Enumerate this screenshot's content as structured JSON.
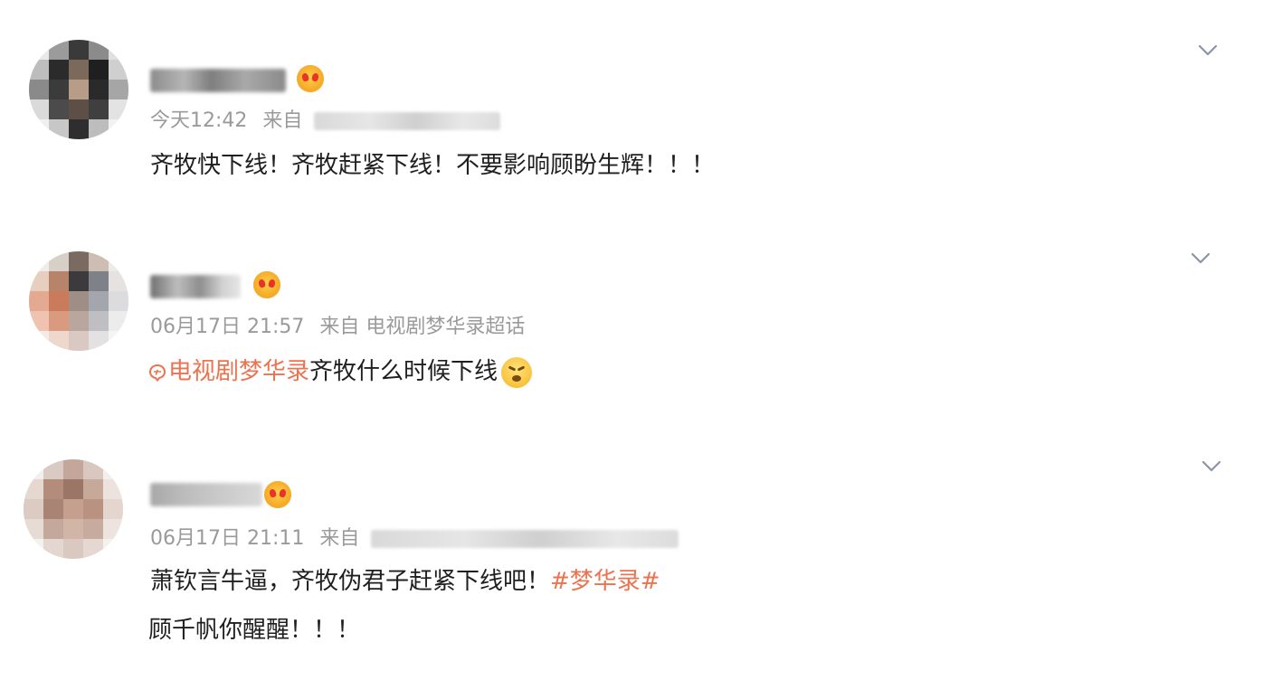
{
  "comments": [
    {
      "time": "今天12:42",
      "from_label": "来自",
      "text": "齐牧快下线！齐牧赶紧下线！不要影响顾盼生辉！！！"
    },
    {
      "time": "06月17日 21:57",
      "from_label": "来自",
      "source": "电视剧梦华录超话",
      "topic_link": "电视剧梦华录",
      "text": "齐牧什么时候下线",
      "emoji": "angry-face-emoji"
    },
    {
      "time": "06月17日 21:11",
      "from_label": "来自",
      "text_line1": "萧钦言牛逼，齐牧伪君子赶紧下线吧！",
      "hashtag": "#梦华录#",
      "text_line2": "顾千帆你醒醒！！！"
    }
  ],
  "icons": {
    "more": "chevron-down-icon",
    "badge": "member-crown-badge-icon",
    "topic": "super-topic-icon"
  },
  "colors": {
    "link": "#eb7350",
    "meta": "#9a9a9a",
    "text": "#1f1f1f",
    "chevron": "#8a93a8"
  }
}
